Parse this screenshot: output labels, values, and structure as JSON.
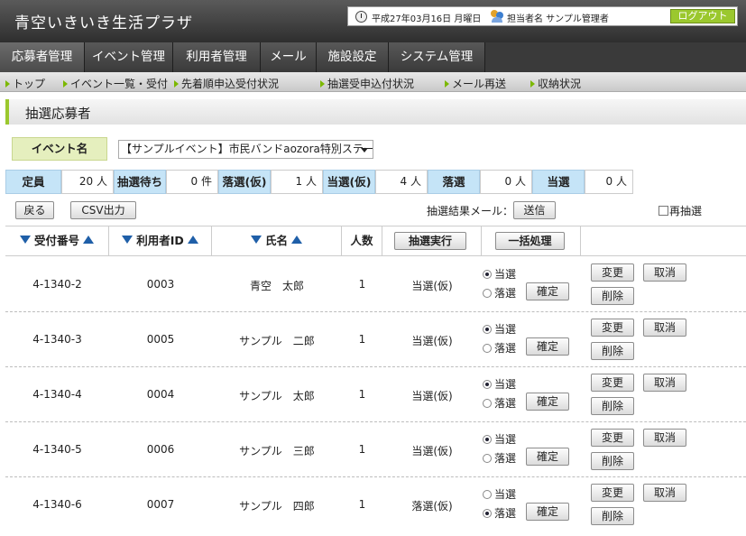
{
  "header": {
    "app_title": "青空いきいき生活プラザ",
    "date": "平成27年03月16日 月曜日",
    "user": "担当者名 サンプル管理者",
    "logout_label": "ログアウト"
  },
  "main_nav": [
    "応募者管理",
    "イベント管理",
    "利用者管理",
    "メール",
    "施設設定",
    "システム管理"
  ],
  "sub_nav": [
    "トップ",
    "イベント一覧・受付",
    "先着順申込受付状況",
    "抽選受申込付状況",
    "メール再送",
    "収納状況"
  ],
  "page_title": "抽選応募者",
  "event": {
    "label": "イベント名",
    "selected": "【サンプルイベント】市民バンドaozora特別ステージ"
  },
  "stats": [
    {
      "label": "定員",
      "value": "20 人"
    },
    {
      "label": "抽選待ち",
      "value": "0 件"
    },
    {
      "label": "落選(仮)",
      "value": "1 人"
    },
    {
      "label": "当選(仮)",
      "value": "4 人"
    },
    {
      "label": "落選",
      "value": "0 人"
    },
    {
      "label": "当選",
      "value": "0 人"
    }
  ],
  "toolbar": {
    "back_label": "戻る",
    "csv_label": "CSV出力",
    "mail_label": "抽選結果メール：",
    "send_label": "送信",
    "redraw_label": "再抽選"
  },
  "table": {
    "headers": {
      "receipt_no": "受付番号",
      "user_id": "利用者ID",
      "name": "氏名",
      "count": "人数",
      "draw_button": "抽選実行",
      "bulk_button": "一括処理"
    },
    "win_label": "当選",
    "lose_label": "落選",
    "confirm_label": "確定",
    "change_label": "変更",
    "cancel_label": "取消",
    "delete_label": "削除",
    "rows": [
      {
        "receipt_no": "4-1340-2",
        "user_id": "0003",
        "name": "青空　太郎",
        "count": "1",
        "status": "当選(仮)",
        "choice": "win"
      },
      {
        "receipt_no": "4-1340-3",
        "user_id": "0005",
        "name": "サンプル　二郎",
        "count": "1",
        "status": "当選(仮)",
        "choice": "win"
      },
      {
        "receipt_no": "4-1340-4",
        "user_id": "0004",
        "name": "サンプル　太郎",
        "count": "1",
        "status": "当選(仮)",
        "choice": "win"
      },
      {
        "receipt_no": "4-1340-5",
        "user_id": "0006",
        "name": "サンプル　三郎",
        "count": "1",
        "status": "当選(仮)",
        "choice": "win"
      },
      {
        "receipt_no": "4-1340-6",
        "user_id": "0007",
        "name": "サンプル　四郎",
        "count": "1",
        "status": "落選(仮)",
        "choice": "lose"
      }
    ]
  }
}
